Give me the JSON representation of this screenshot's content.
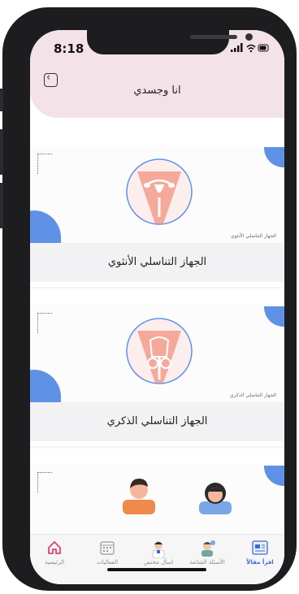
{
  "status_bar": {
    "time": "8:18"
  },
  "header": {
    "title": "انا وجسدي",
    "back_icon": "chevron-left-icon"
  },
  "cards": [
    {
      "caption": "الجهاز التناسلي الأنثوي",
      "image_label": "الجهاز التناسلي الأنثوي",
      "image": "female-reproductive-system-illustration"
    },
    {
      "caption": "الجهاز التناسلي الذكري",
      "image_label": "الجهاز التناسلي الذكري",
      "image": "male-reproductive-system-illustration"
    },
    {
      "caption": "",
      "image": "boy-and-girl-illustration"
    }
  ],
  "tabbar": {
    "tabs": [
      {
        "label": "اقرأ مقالاً",
        "icon": "newspaper-icon",
        "active": true
      },
      {
        "label": "الأسئلة الشائعة",
        "icon": "faq-people-icon",
        "active": false
      },
      {
        "label": "اسأل مختص",
        "icon": "doctor-icon",
        "active": false
      },
      {
        "label": "الفعاليات",
        "icon": "calendar-icon",
        "active": false
      },
      {
        "label": "الرئيسية",
        "icon": "home-icon",
        "active": false
      }
    ]
  },
  "colors": {
    "header_bg": "#f3e2e7",
    "accent_blue": "#5f92e6",
    "home_icon": "#e0416c",
    "skin": "#f4a99a"
  }
}
